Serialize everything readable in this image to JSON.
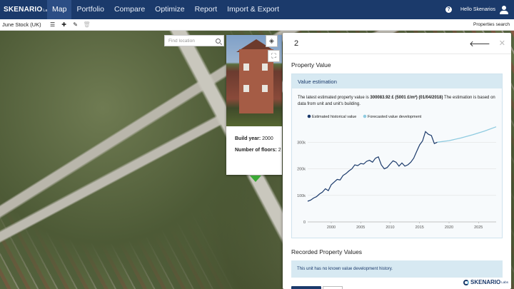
{
  "nav": {
    "brand": "SKENARIO",
    "brand_suffix": "Labs",
    "items": [
      {
        "label": "Map",
        "active": true
      },
      {
        "label": "Portfolio",
        "active": false
      },
      {
        "label": "Compare",
        "active": false
      },
      {
        "label": "Optimize",
        "active": false
      },
      {
        "label": "Report",
        "active": false
      },
      {
        "label": "Import & Export",
        "active": false
      }
    ],
    "help_icon": "?",
    "greeting": "Hello Skenarios"
  },
  "toolbar": {
    "stock_title": "June Stock (UK)",
    "properties_search": "Properties search",
    "icons": [
      "list-icon",
      "plus-icon",
      "pencil-icon",
      "trash-icon"
    ]
  },
  "map": {
    "search_placeholder": "Find location",
    "popup": {
      "build_year_label": "Build year:",
      "build_year": "2000",
      "floors_label": "Number of floors:",
      "floors": "2"
    }
  },
  "panel": {
    "title": "2",
    "property_value_heading": "Property Value",
    "estimation_heading": "Value estimation",
    "estimation_text_1": "The latest estimated property value is",
    "estimation_value": "300083.92 £ (5001 £/m²) (01/04/2018)",
    "estimation_text_2": "The estimation is based on data from unit and unit's building.",
    "recorded_heading": "Recorded Property Values",
    "no_history": "This unit has no known value development history."
  },
  "watermark": {
    "brand": "SKENARIO",
    "suffix": "Labs"
  },
  "colors": {
    "nav": "#1b3a6b",
    "historical": "#1b3a6b",
    "forecast": "#8fcbe0",
    "accent": "#3aa935"
  },
  "chart_data": {
    "type": "line",
    "title": "",
    "xlabel": "",
    "ylabel": "",
    "xlim": [
      1996,
      2028
    ],
    "ylim": [
      0,
      360000
    ],
    "x_ticks": [
      "2000",
      "2005",
      "2010",
      "2015",
      "2020",
      "2025"
    ],
    "y_ticks": [
      "0",
      "100k",
      "200k",
      "300k"
    ],
    "legend_position": "top",
    "series": [
      {
        "name": "Estimated historical value",
        "color": "#1b3a6b",
        "x": [
          1996,
          1996.5,
          1997,
          1997.5,
          1998,
          1998.5,
          1999,
          1999.5,
          2000,
          2000.5,
          2001,
          2001.5,
          2002,
          2002.5,
          2003,
          2003.5,
          2004,
          2004.5,
          2005,
          2005.5,
          2006,
          2006.5,
          2007,
          2007.5,
          2008,
          2008.5,
          2009,
          2009.5,
          2010,
          2010.5,
          2011,
          2011.5,
          2012,
          2012.5,
          2013,
          2013.5,
          2014,
          2014.5,
          2015,
          2015.5,
          2016,
          2016.5,
          2017,
          2017.5,
          2018
        ],
        "values": [
          78000,
          82000,
          90000,
          95000,
          105000,
          112000,
          125000,
          118000,
          140000,
          150000,
          160000,
          158000,
          175000,
          182000,
          192000,
          200000,
          215000,
          212000,
          220000,
          218000,
          228000,
          232000,
          225000,
          240000,
          245000,
          215000,
          200000,
          205000,
          218000,
          230000,
          225000,
          210000,
          222000,
          210000,
          215000,
          225000,
          240000,
          265000,
          290000,
          305000,
          340000,
          330000,
          325000,
          295000,
          300083
        ]
      },
      {
        "name": "Forecasted value development",
        "color": "#8fcbe0",
        "x": [
          2018,
          2020,
          2022,
          2024,
          2026,
          2028
        ],
        "values": [
          300083,
          306000,
          316000,
          328000,
          342000,
          358000
        ]
      }
    ]
  }
}
